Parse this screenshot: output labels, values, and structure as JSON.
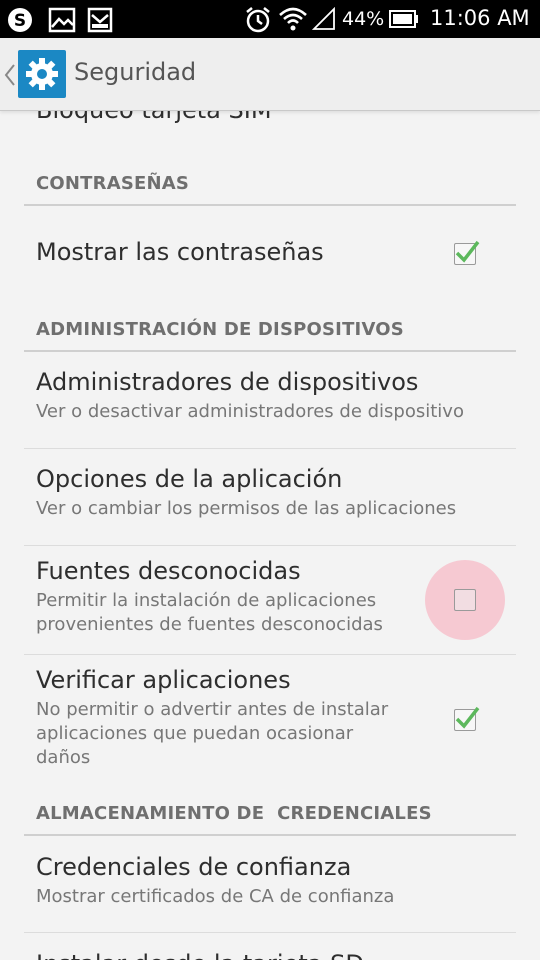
{
  "status_bar": {
    "battery": "44%",
    "time": "11:06 AM"
  },
  "action_bar": {
    "title": "Seguridad"
  },
  "partial_top_item": "Bloqueo tarjeta SIM",
  "sections": {
    "passwords": "CONTRASEÑAS",
    "device_admin": "ADMINISTRACIÓN DE DISPOSITIVOS",
    "credentials": "ALMACENAMIENTO DE  CREDENCIALES"
  },
  "items": {
    "show_passwords": {
      "title": "Mostrar las contraseñas",
      "checked": true
    },
    "device_admins": {
      "title": "Administradores de dispositivos",
      "summary": "Ver o desactivar administradores de dispositivo"
    },
    "app_options": {
      "title": "Opciones de la aplicación",
      "summary": "Ver o cambiar los permisos de las aplicaciones"
    },
    "unknown_sources": {
      "title": "Fuentes desconocidas",
      "summary_line1": "Permitir la instalación de aplicaciones",
      "summary_line2": "provenientes de fuentes desconocidas",
      "checked": false
    },
    "verify_apps": {
      "title": "Verificar aplicaciones",
      "summary_line1": "No permitir o advertir antes de instalar",
      "summary_line2": "aplicaciones que puedan ocasionar",
      "summary_line3": "daños",
      "checked": true
    },
    "trusted_credentials": {
      "title": "Credenciales de confianza",
      "summary": "Mostrar certificados de CA de confianza"
    },
    "install_from_sd": {
      "title": "Instalar desde la tarjeta SD"
    }
  },
  "colors": {
    "check_green": "#5cb85c",
    "ripple_pink": "#f6c9d2",
    "app_icon_blue": "#1b88c4"
  }
}
